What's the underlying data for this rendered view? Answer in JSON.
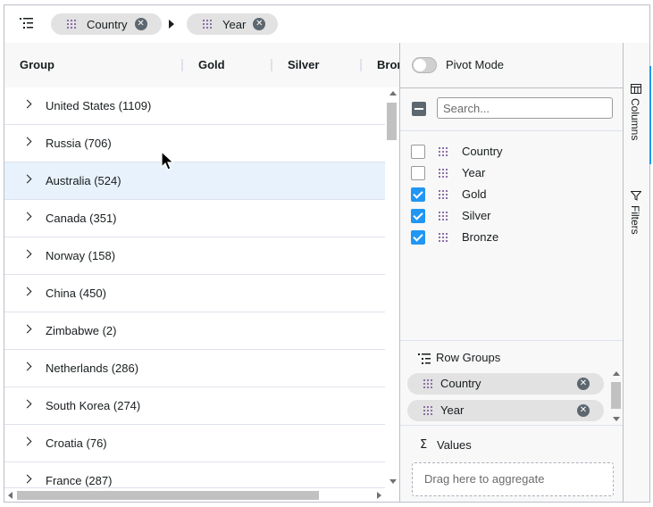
{
  "group_panel": {
    "chips": [
      {
        "label": "Country"
      },
      {
        "label": "Year"
      }
    ]
  },
  "header": {
    "columns": [
      "Group",
      "Gold",
      "Silver",
      "Bronze"
    ]
  },
  "rows": [
    {
      "label": "United States (1109)"
    },
    {
      "label": "Russia (706)"
    },
    {
      "label": "Australia (524)"
    },
    {
      "label": "Canada (351)"
    },
    {
      "label": "Norway (158)"
    },
    {
      "label": "China (450)"
    },
    {
      "label": "Zimbabwe (2)"
    },
    {
      "label": "Netherlands (286)"
    },
    {
      "label": "South Korea (274)"
    },
    {
      "label": "Croatia (76)"
    },
    {
      "label": "France (287)"
    }
  ],
  "hovered_row": "Australia (524)",
  "tool_panel": {
    "pivot_mode_label": "Pivot Mode",
    "pivot_mode_on": false,
    "search_placeholder": "Search...",
    "columns": [
      {
        "label": "Country",
        "checked": false
      },
      {
        "label": "Year",
        "checked": false
      },
      {
        "label": "Gold",
        "checked": true
      },
      {
        "label": "Silver",
        "checked": true
      },
      {
        "label": "Bronze",
        "checked": true
      }
    ],
    "row_groups_title": "Row Groups",
    "row_groups": [
      {
        "label": "Country"
      },
      {
        "label": "Year"
      }
    ],
    "values_title": "Values",
    "values_sigma": "Σ",
    "values_drop_text": "Drag here to aggregate"
  },
  "sidebar": {
    "tabs": [
      {
        "label": "Columns",
        "icon": "columns-icon",
        "active": true
      },
      {
        "label": "Filters",
        "icon": "filter-icon",
        "active": false
      }
    ]
  },
  "colors": {
    "accent": "#2196f3",
    "row_hover": "#e8f2fc",
    "chip_bg": "#e2e2e2",
    "header_bg": "#f8f8f8"
  }
}
